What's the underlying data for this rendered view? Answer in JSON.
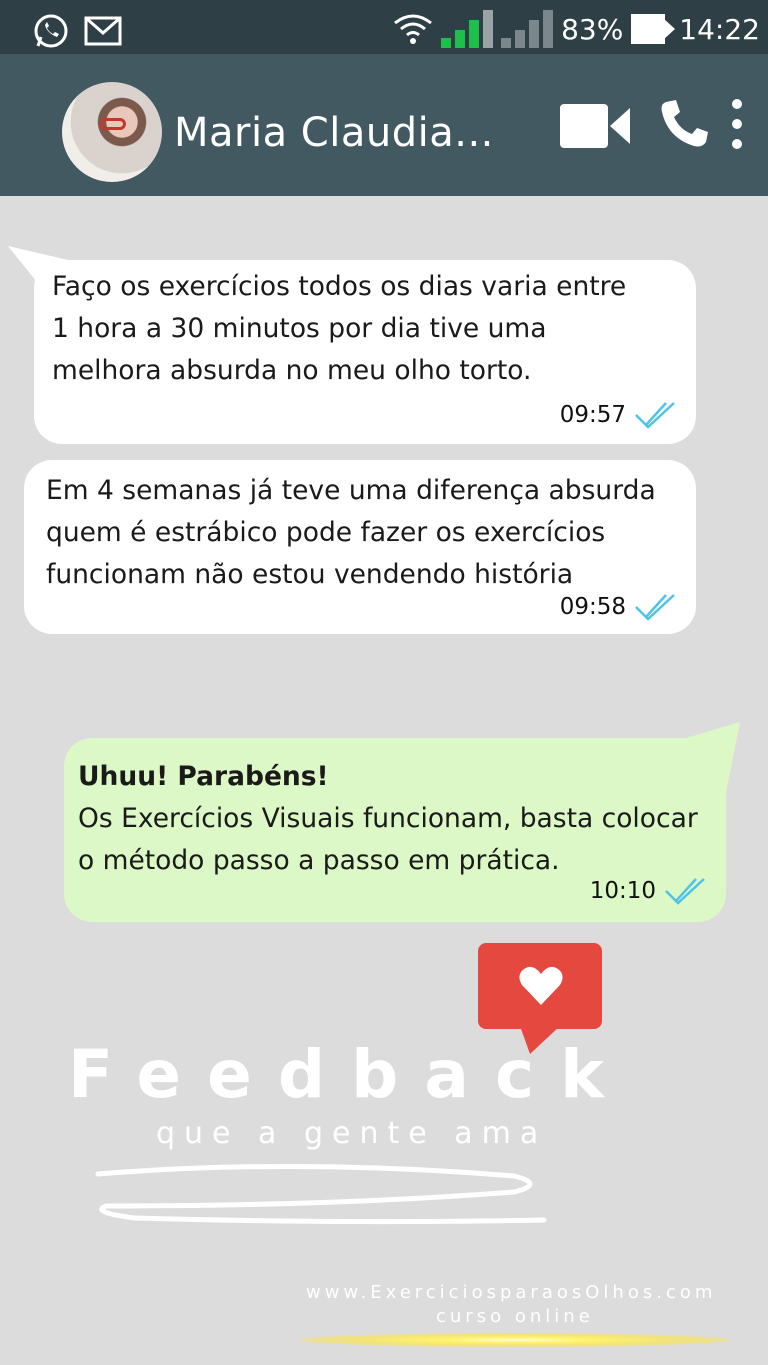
{
  "status_bar": {
    "battery_percent": "83%",
    "time": "14:22",
    "icons": [
      "whatsapp-icon",
      "mail-icon",
      "wifi-icon",
      "signal-icon",
      "battery-icon"
    ]
  },
  "header": {
    "contact_name": "Maria Claudia...",
    "icons": [
      "video-call-icon",
      "phone-icon",
      "more-options-icon"
    ]
  },
  "messages": [
    {
      "text": "Faço os exercícios todos os dias varia entre\n1 hora a 30 minutos por dia tive uma\nmelhora absurda no meu olho torto.",
      "time": "09:57",
      "status": "read"
    },
    {
      "text": "Em 4 semanas já teve uma diferença absurda\nquem é estrábico pode fazer os exercícios\nfuncionam não estou vendendo história",
      "time": "09:58",
      "status": "read"
    },
    {
      "bold": "Uhuu! Parabéns!",
      "text": "Os Exercícios Visuais funcionam, basta colocar\no método passo a passo em prática.",
      "time": "10:10",
      "status": "read"
    }
  ],
  "feedback": {
    "title": "Feedback",
    "subtitle": "que a gente ama"
  },
  "footer": {
    "url": "www.ExerciciosparaosOlhos.com",
    "subtitle": "curso online"
  },
  "colors": {
    "status_bar": "#2f3f46",
    "header": "#425962",
    "chat_background": "#dcdcdc",
    "outgoing_bubble": "#dcf8c6",
    "read_ticks": "#4fc3e8",
    "heart_badge": "#e5483f"
  }
}
